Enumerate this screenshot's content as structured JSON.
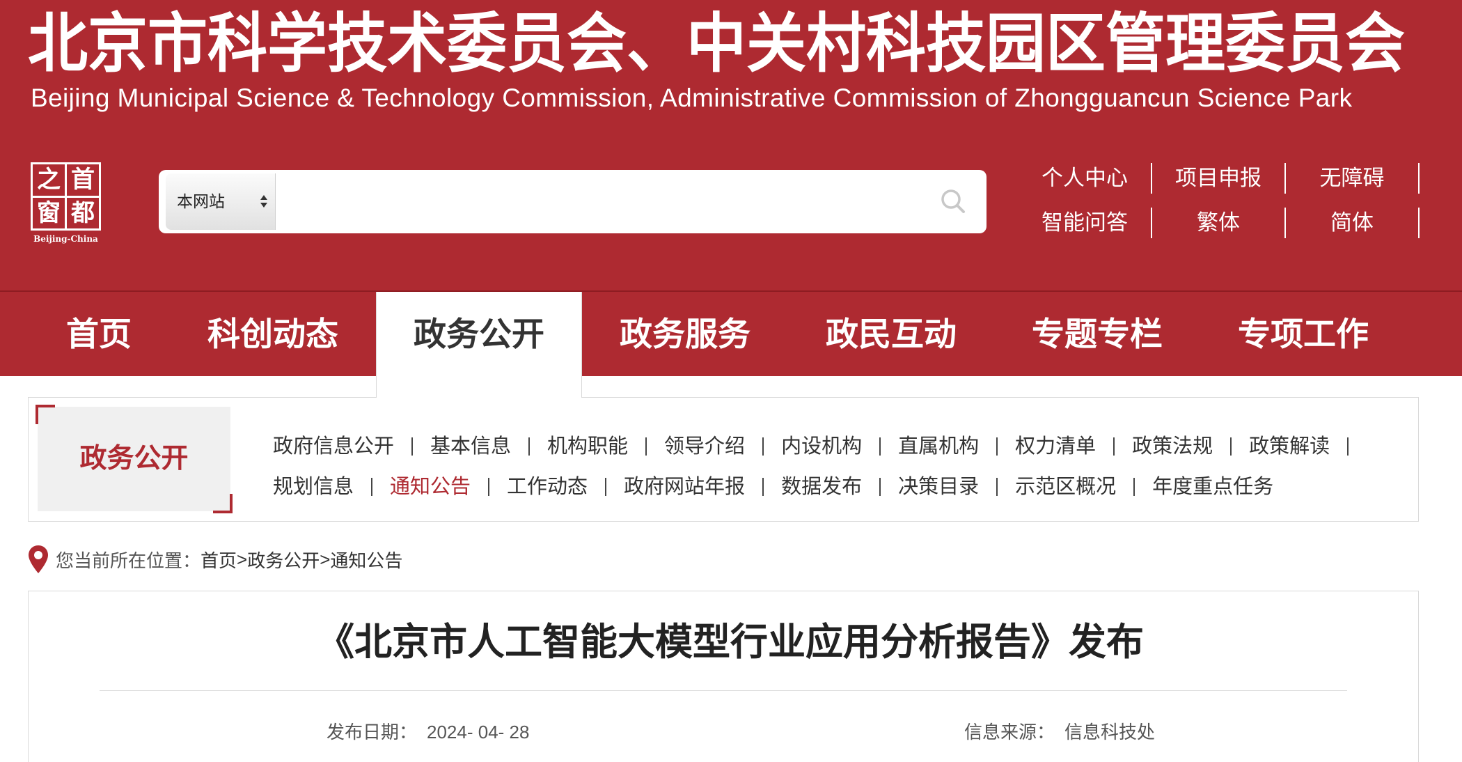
{
  "colors": {
    "brand_red": "#ae2a31",
    "text": "#333333",
    "muted_text": "#555555"
  },
  "icons": {
    "logo": "beijing-china-logo",
    "scope_arrows": "select-arrows-icon",
    "search": "search-icon",
    "location": "location-pin-icon"
  },
  "header": {
    "title_cn": "北京市科学技术委员会、中关村科技园区管理委员会",
    "title_en": "Beijing Municipal Science & Technology Commission, Administrative Commission of Zhongguancun Science Park",
    "logo": {
      "cells": [
        "之",
        "首",
        "窗",
        "都"
      ],
      "caption": "Beijing-China"
    },
    "search": {
      "scope": "本网站",
      "value": ""
    },
    "links": [
      [
        "个人中心",
        "项目申报",
        "无障碍"
      ],
      [
        "智能问答",
        "繁体",
        "简体"
      ]
    ]
  },
  "nav": {
    "items": [
      "首页",
      "科创动态",
      "政务公开",
      "政务服务",
      "政民互动",
      "专题专栏",
      "专项工作"
    ],
    "active_index": 2
  },
  "section": {
    "title": "政务公开",
    "rows": [
      [
        {
          "label": "政府信息公开"
        },
        {
          "label": "基本信息"
        },
        {
          "label": "机构职能"
        },
        {
          "label": "领导介绍"
        },
        {
          "label": "内设机构"
        },
        {
          "label": "直属机构"
        },
        {
          "label": "权力清单"
        },
        {
          "label": "政策法规"
        },
        {
          "label": "政策解读"
        }
      ],
      [
        {
          "label": "规划信息"
        },
        {
          "label": "通知公告",
          "current": true
        },
        {
          "label": "工作动态"
        },
        {
          "label": "政府网站年报"
        },
        {
          "label": "数据发布"
        },
        {
          "label": "决策目录"
        },
        {
          "label": "示范区概况"
        },
        {
          "label": "年度重点任务"
        }
      ]
    ]
  },
  "breadcrumb": {
    "prefix": "您当前所在位置：",
    "items": [
      "首页",
      "政务公开",
      "通知公告"
    ],
    "separator": ">"
  },
  "article": {
    "title": "《北京市人工智能大模型行业应用分析报告》发布",
    "date_label": "发布日期：",
    "date": "2024- 04- 28",
    "source_label": "信息来源：",
    "source": "信息科技处"
  }
}
